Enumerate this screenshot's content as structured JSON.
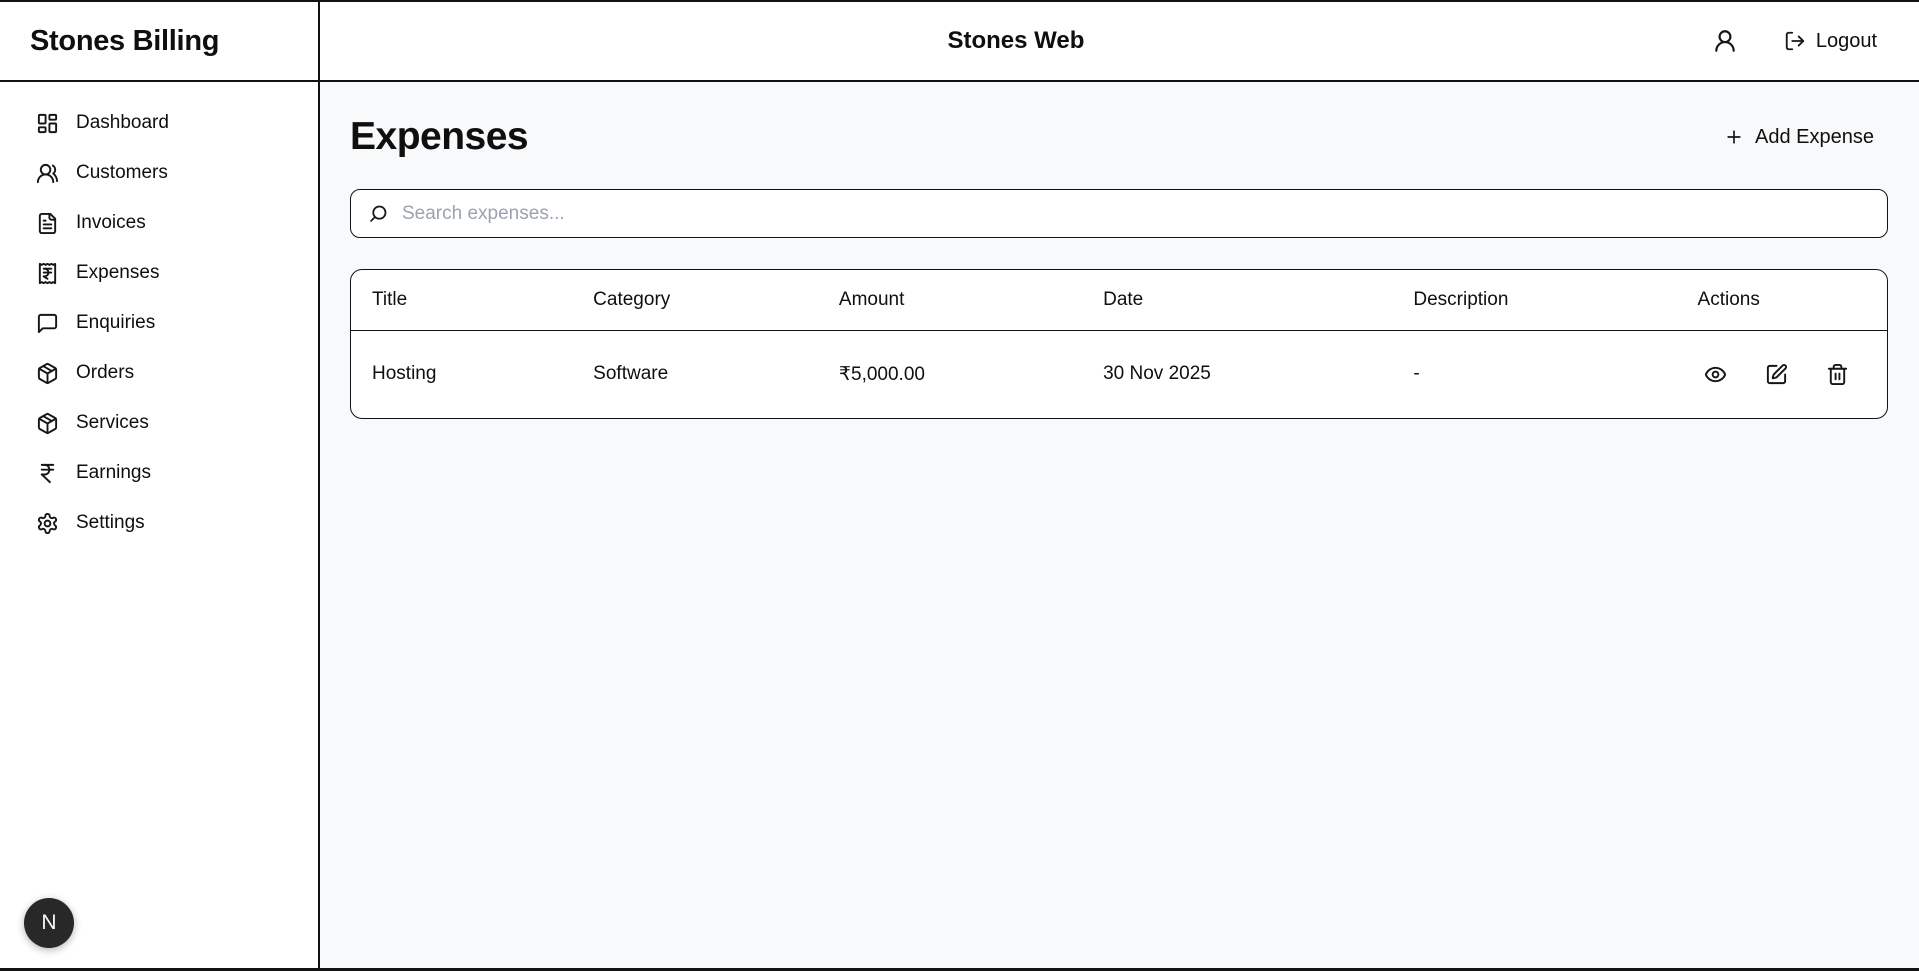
{
  "app": {
    "logo": "Stones Billing",
    "header_title": "Stones Web",
    "logout_label": "Logout"
  },
  "sidebar": {
    "items": [
      {
        "label": "Dashboard",
        "icon": "dashboard-icon"
      },
      {
        "label": "Customers",
        "icon": "users-icon"
      },
      {
        "label": "Invoices",
        "icon": "file-text-icon"
      },
      {
        "label": "Expenses",
        "icon": "receipt-rupee-icon"
      },
      {
        "label": "Enquiries",
        "icon": "message-square-icon"
      },
      {
        "label": "Orders",
        "icon": "package-icon"
      },
      {
        "label": "Services",
        "icon": "package-icon"
      },
      {
        "label": "Earnings",
        "icon": "rupee-icon"
      },
      {
        "label": "Settings",
        "icon": "gear-icon"
      }
    ],
    "avatar_initial": "N"
  },
  "page": {
    "title": "Expenses",
    "add_button_label": "Add Expense",
    "search_placeholder": "Search expenses...",
    "search_value": ""
  },
  "table": {
    "columns": [
      "Title",
      "Category",
      "Amount",
      "Date",
      "Description",
      "Actions"
    ],
    "rows": [
      {
        "title": "Hosting",
        "category": "Software",
        "amount": "₹5,000.00",
        "date": "30 Nov 2025",
        "description": "-"
      }
    ]
  },
  "colors": {
    "border": "#121212",
    "main_background": "#f8f9fa",
    "surface": "#ffffff",
    "text": "#0f0f0f",
    "placeholder": "#9aa3af",
    "avatar_background": "#282828",
    "avatar_text": "#fafafa"
  }
}
